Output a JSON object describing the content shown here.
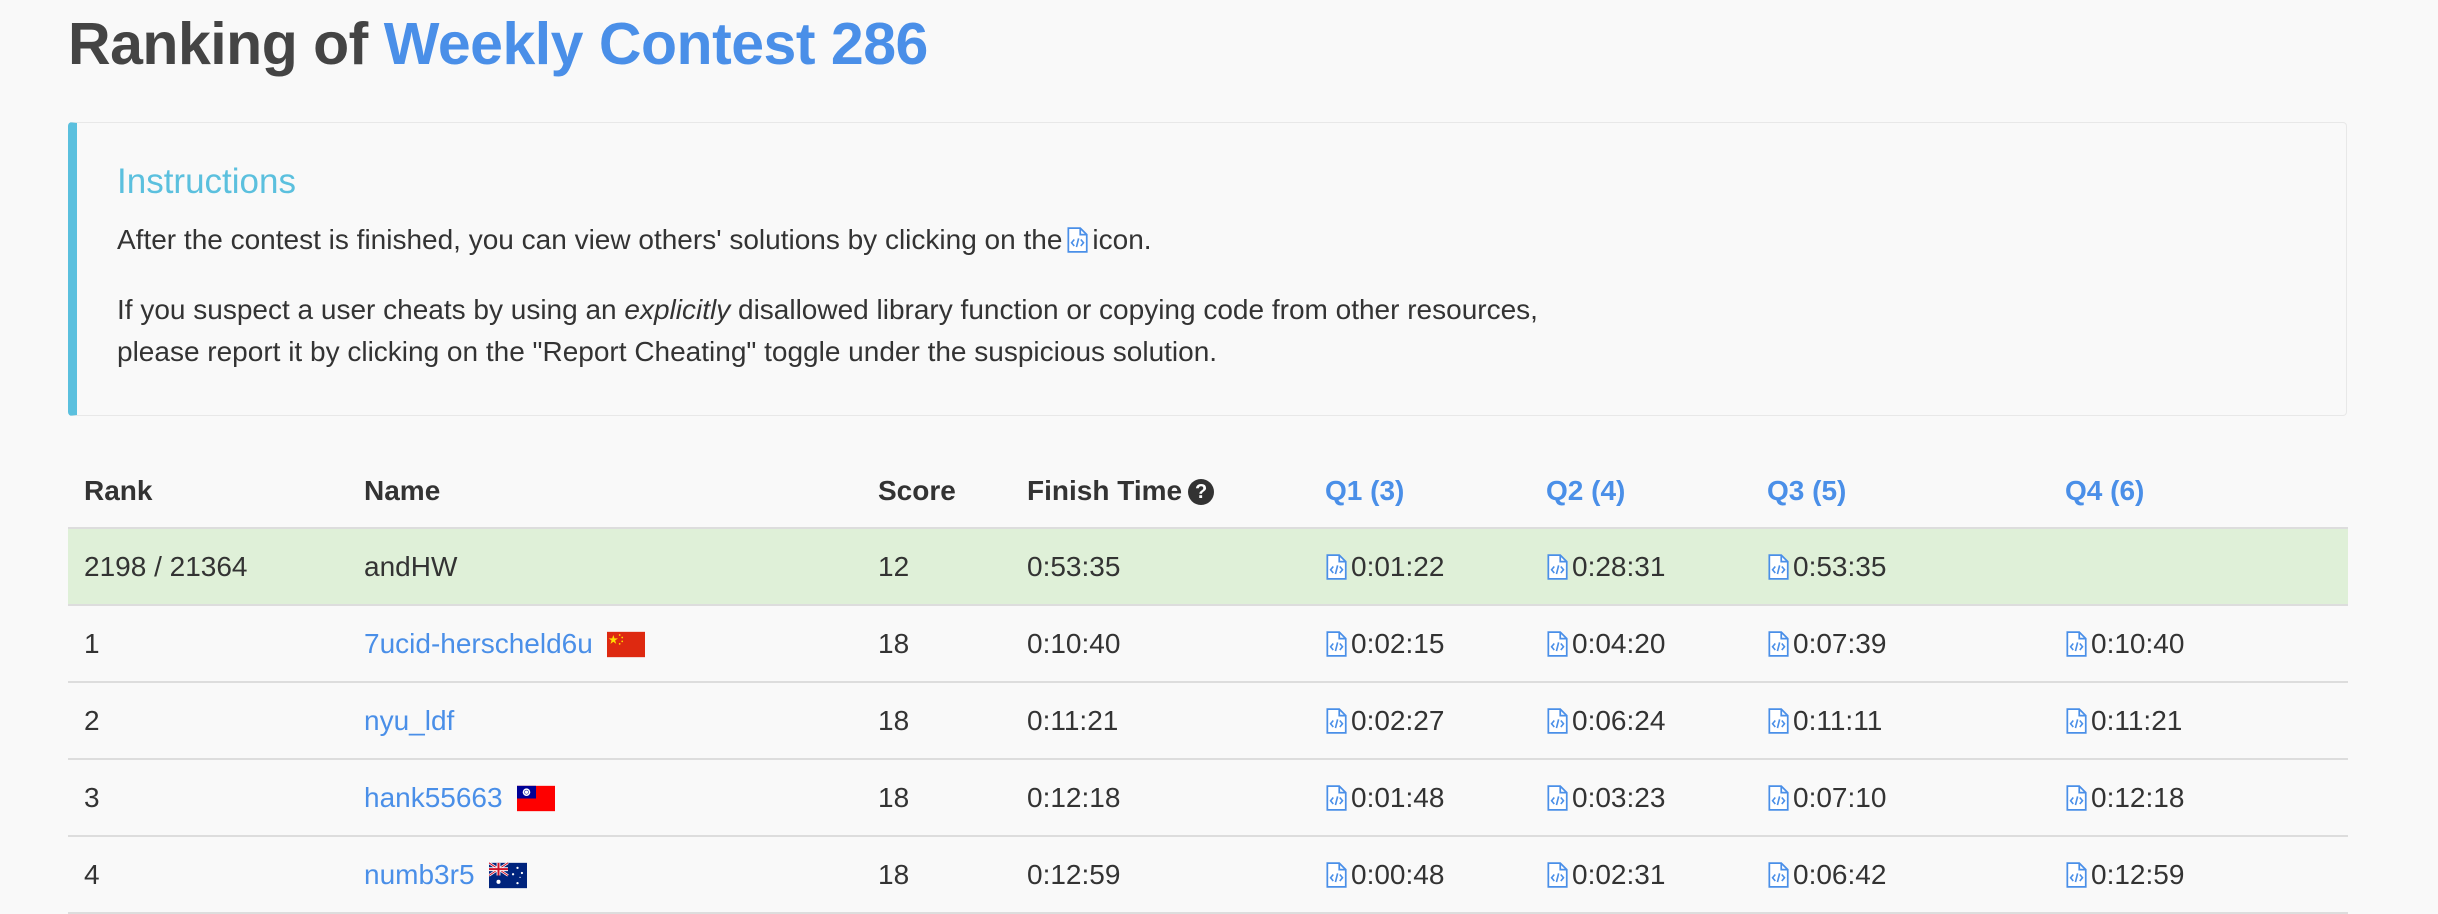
{
  "header": {
    "title_prefix": "Ranking of",
    "contest_name": "Weekly Contest 286"
  },
  "instructions": {
    "heading": "Instructions",
    "line1_before": "After the contest is finished, you can view others' solutions by clicking on the",
    "line1_after": "icon.",
    "line2_before": "If you suspect a user cheats by using an",
    "line2_emphasis": "explicitly",
    "line2_after": "disallowed library function or copying code from other resources,",
    "line3": "please report it by clicking on the \"Report Cheating\" toggle under the suspicious solution."
  },
  "table": {
    "columns": {
      "rank": "Rank",
      "name": "Name",
      "score": "Score",
      "finish_time": "Finish Time",
      "q1": "Q1 (3)",
      "q2": "Q2 (4)",
      "q3": "Q3 (5)",
      "q4": "Q4 (6)"
    },
    "self_row": {
      "rank": "2198 / 21364",
      "name": "andHW",
      "score": "12",
      "finish_time": "0:53:35",
      "q1": "0:01:22",
      "q2": "0:28:31",
      "q3": "0:53:35",
      "q4": ""
    },
    "rows": [
      {
        "rank": "1",
        "name": "7ucid-herscheld6u",
        "flag": "china-flag-icon",
        "score": "18",
        "finish_time": "0:10:40",
        "q1": "0:02:15",
        "q2": "0:04:20",
        "q3": "0:07:39",
        "q4": "0:10:40"
      },
      {
        "rank": "2",
        "name": "nyu_ldf",
        "score": "18",
        "finish_time": "0:11:21",
        "q1": "0:02:27",
        "q2": "0:06:24",
        "q3": "0:11:11",
        "q4": "0:11:21"
      },
      {
        "rank": "3",
        "name": "hank55663",
        "flag": "taiwan-flag-icon",
        "score": "18",
        "finish_time": "0:12:18",
        "q1": "0:01:48",
        "q2": "0:03:23",
        "q3": "0:07:10",
        "q4": "0:12:18"
      },
      {
        "rank": "4",
        "name": "numb3r5",
        "flag": "australia-flag-icon",
        "score": "18",
        "finish_time": "0:12:59",
        "q1": "0:00:48",
        "q2": "0:02:31",
        "q3": "0:06:42",
        "q4": "0:12:59"
      }
    ]
  },
  "colors": {
    "accent": "#4a8fe8",
    "info": "#5bc0de",
    "self_row_bg": "#dff0d8"
  }
}
